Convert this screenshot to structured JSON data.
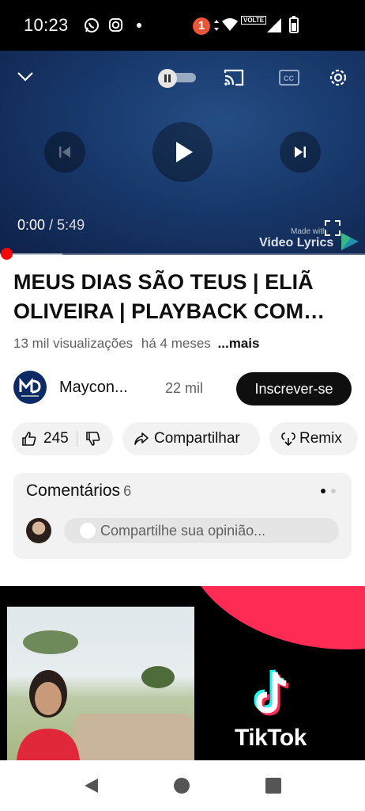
{
  "status_bar": {
    "time": "10:23",
    "notification_count": "1",
    "network_label": "VOLTE",
    "icons": [
      "whatsapp-icon",
      "instagram-icon",
      "dot-icon",
      "vibrate-icon",
      "wifi-icon",
      "signal-icon",
      "battery-icon"
    ]
  },
  "player": {
    "current_time": "0:00",
    "separator": "/",
    "duration": "5:49",
    "watermark_small": "Made with",
    "watermark_big": "Video Lyrics",
    "progress_fraction": 0.0,
    "buffer_fraction": 0.17,
    "icons": [
      "chevron-down-icon",
      "autoplay-toggle",
      "cast-icon",
      "captions-icon",
      "settings-icon",
      "previous-icon",
      "play-icon",
      "next-icon",
      "fullscreen-icon"
    ]
  },
  "video": {
    "title": "MEUS DIAS SÃO TEUS | ELIÃ OLIVEIRA | PLAYBACK COM LETRA",
    "views": "13 mil visualizações",
    "age": "há 4 meses",
    "more": "...mais"
  },
  "channel": {
    "name": "Maycon...",
    "subscribers": "22 mil",
    "subscribe_label": "Inscrever-se"
  },
  "actions": {
    "likes": "245",
    "share_label": "Compartilhar",
    "remix_label": "Remix"
  },
  "comments": {
    "title": "Comentários",
    "count": "6",
    "placeholder": "Compartilhe sua opinião..."
  },
  "ad": {
    "brand": "TikTok"
  },
  "colors": {
    "accent_red": "#ff0000",
    "subscribe_bg": "#0f0f0f",
    "tiktok_pink": "#fe2c55",
    "tiktok_cyan": "#25f4ee"
  }
}
